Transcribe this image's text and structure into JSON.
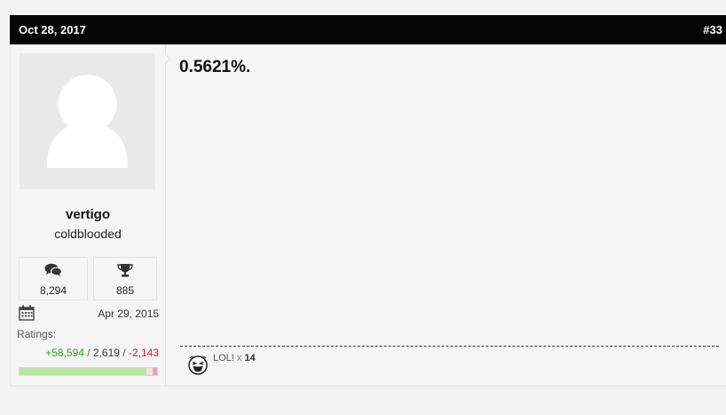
{
  "post": {
    "date": "Oct 28, 2017",
    "number": "#33",
    "message": "0.5621%."
  },
  "user": {
    "username": "vertigo",
    "title": "coldblooded",
    "messages": "8,294",
    "trophies": "885",
    "join_date": "Apr 29, 2015",
    "ratings_label": "Ratings:",
    "ratings": {
      "positive": "+58,594",
      "neutral": "2,619",
      "negative": "-2,143",
      "separator": " / "
    },
    "ratings_fraction": {
      "positive": 0.925,
      "neutral": 0.04,
      "negative": 0.035
    }
  },
  "reaction": {
    "name": "LOL!",
    "multiplier": "x",
    "count": "14",
    "icon": "laughing-face-icon"
  },
  "colors": {
    "header_bg": "#050505",
    "positive": "#3c9a2a",
    "negative": "#d02020"
  }
}
